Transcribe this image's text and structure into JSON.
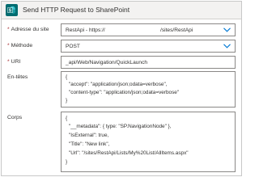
{
  "header": {
    "title": "Send HTTP Request to SharePoint",
    "icon": "sharepoint-icon",
    "icon_color": "#036c70"
  },
  "fields": {
    "site": {
      "label": "Adresse du site",
      "value_prefix": "RestApi - https://",
      "value_suffix": "/sites/RestApi"
    },
    "method": {
      "label": "Méthode",
      "value": "POST"
    },
    "uri": {
      "label": "URI",
      "value": "_api/Web/Navigation/QuickLaunch"
    },
    "headers": {
      "label": "En-têtes",
      "lines": [
        "{",
        "\"accept\": \"application/json;odata=verbose\",",
        "\"content-type\": \"application/json;odata=verbose\"",
        "}"
      ]
    },
    "body": {
      "label": "Corps",
      "lines": [
        "{",
        "\"__metadata\": { type: \"SP.NavigationNode\" },",
        "\"IsExternal\": true,",
        "\"Title\": \"New link\",",
        "\"Url\": \"/sites/RestApi/Lists/My%20List/AllItems.aspx\"",
        "}"
      ]
    }
  },
  "required_marker": "*",
  "accent_color": "#0078d4"
}
